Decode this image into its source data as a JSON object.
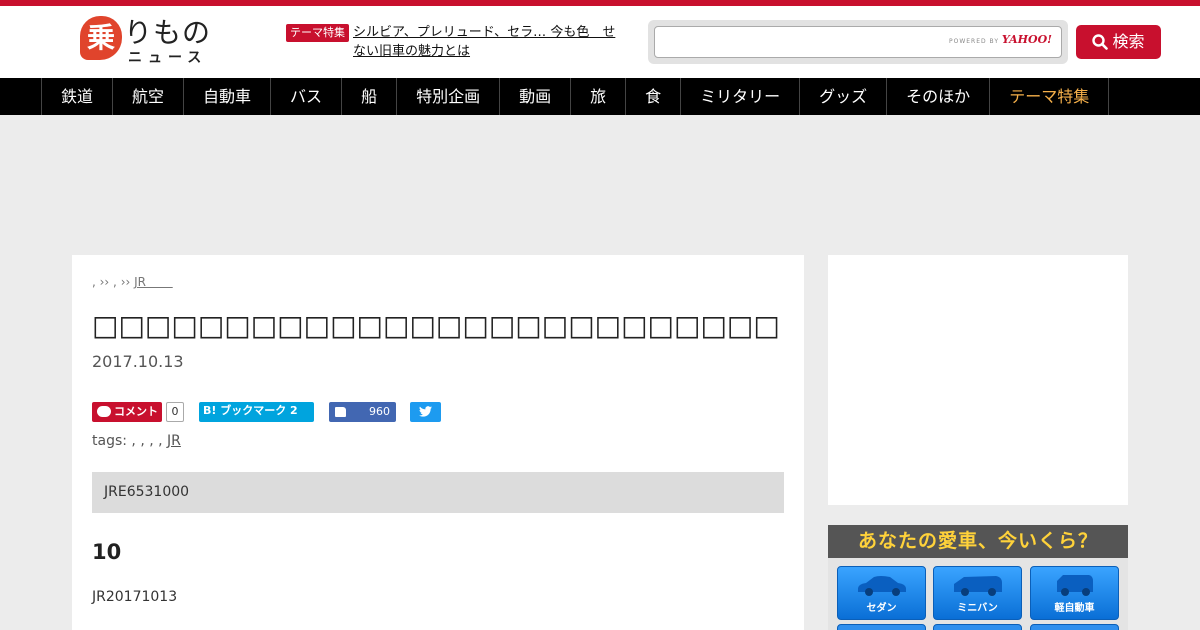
{
  "header": {
    "logo": {
      "mark": "乗",
      "main": "りもの",
      "sub": "ニュース"
    },
    "theme_badge": "テーマ特集",
    "theme_link": "シルビア、プレリュード、セラ… 今も色　せない旧車の魅力とは",
    "search": {
      "value": "",
      "placeholder": "",
      "powered_by": "POWERED BY",
      "provider": "YAHOO!",
      "button_label": "検索"
    }
  },
  "nav": {
    "items": [
      "鉄道",
      "航空",
      "自動車",
      "バス",
      "船",
      "特別企画",
      "動画",
      "旅",
      "食",
      "ミリタリー",
      "グッズ",
      "そのほか",
      "テーマ特集"
    ]
  },
  "article": {
    "breadcrumb": {
      "sep1": ", ›› ,",
      "sep2": "››",
      "crumb": "JR"
    },
    "title": "□□□□□□□□□□□□□□□□□□□□□□□□□□□□□□JR□□□",
    "date": "2017.10.13",
    "share": {
      "comment_label": "コメント",
      "comment_count": "0",
      "hatena_label": "B! ブックマーク 2",
      "fb_count": "960"
    },
    "tags": {
      "label": "tags:",
      "separators": ", , , ,",
      "tag": "JR"
    },
    "lead": "JRE6531000",
    "heading": "10",
    "body": "JR20171013"
  },
  "car_widget": {
    "title": "あなたの愛車、今いくら？",
    "buttons": [
      "セダン",
      "ミニバン",
      "軽自動車"
    ]
  },
  "colors": {
    "brand_red": "#c8102e",
    "nav_bg": "#000000",
    "nav_accent": "#f6b04a",
    "widget_title": "#ffd23a"
  }
}
